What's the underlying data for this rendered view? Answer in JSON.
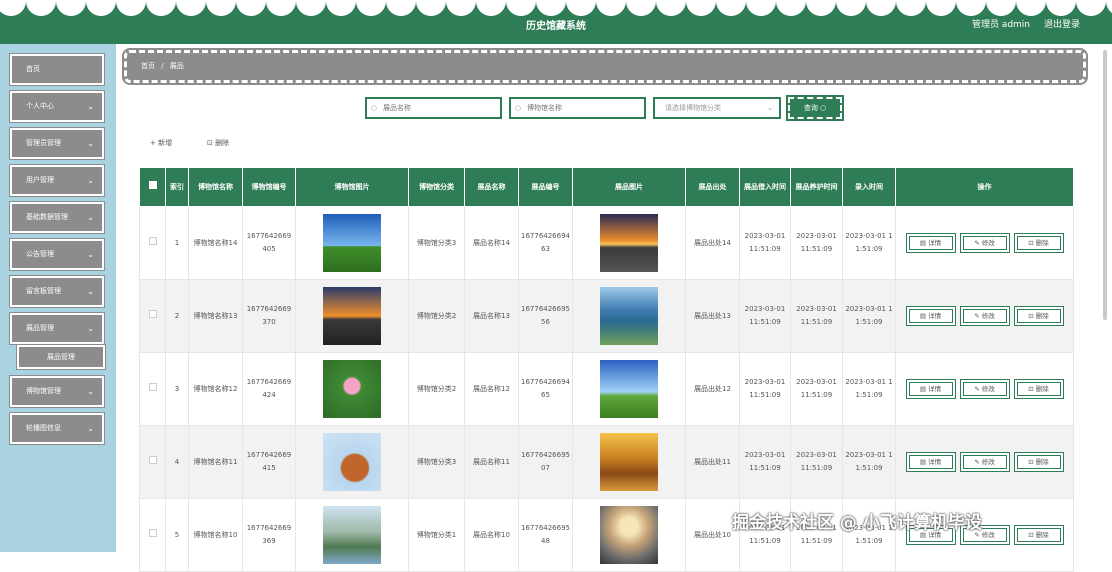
{
  "header": {
    "title": "历史馆藏系统",
    "user": "管理员 admin",
    "logout": "退出登录"
  },
  "sidebar": {
    "items": [
      {
        "label": "首页",
        "chevron": false
      },
      {
        "label": "个人中心",
        "chevron": true
      },
      {
        "label": "管理员管理",
        "chevron": true
      },
      {
        "label": "用户管理",
        "chevron": true
      },
      {
        "label": "基础数据管理",
        "chevron": true
      },
      {
        "label": "公告管理",
        "chevron": true
      },
      {
        "label": "留言板管理",
        "chevron": true
      },
      {
        "label": "展品管理",
        "chevron": true
      },
      {
        "label": "博物馆管理",
        "chevron": true
      },
      {
        "label": "轮播图信息",
        "chevron": true
      }
    ],
    "sub_item": "展品管理"
  },
  "breadcrumb": {
    "home": "首页",
    "sep": "/",
    "current": "展品"
  },
  "search": {
    "name_placeholder": "展品名称",
    "museum_placeholder": "博物馆名称",
    "category_placeholder": "请选择博物馆分类",
    "button": "查询"
  },
  "toolbar": {
    "add": "+ 新增",
    "delete": "删除"
  },
  "table": {
    "headers": [
      "索引",
      "博物馆名称",
      "博物馆编号",
      "博物馆图片",
      "博物馆分类",
      "展品名称",
      "展品编号",
      "展品图片",
      "展品出处",
      "展品借入时间",
      "展品养护时间",
      "录入时间",
      "操作"
    ],
    "rows": [
      {
        "idx": "1",
        "museum": "博物馆名称14",
        "museum_no": "1677642669405",
        "category": "博物馆分类3",
        "name": "展品名称14",
        "no": "1677642669463",
        "origin": "展品出处14",
        "borrow": "2023-03-01 11:51:09",
        "care": "2023-03-01 11:51:09",
        "entry": "2023-03-01 11:51:09"
      },
      {
        "idx": "2",
        "museum": "博物馆名称13",
        "museum_no": "1677642669370",
        "category": "博物馆分类2",
        "name": "展品名称13",
        "no": "1677642669556",
        "origin": "展品出处13",
        "borrow": "2023-03-01 11:51:09",
        "care": "2023-03-01 11:51:09",
        "entry": "2023-03-01 11:51:09"
      },
      {
        "idx": "3",
        "museum": "博物馆名称12",
        "museum_no": "1677642669424",
        "category": "博物馆分类2",
        "name": "展品名称12",
        "no": "1677642669465",
        "origin": "展品出处12",
        "borrow": "2023-03-01 11:51:09",
        "care": "2023-03-01 11:51:09",
        "entry": "2023-03-01 11:51:09"
      },
      {
        "idx": "4",
        "museum": "博物馆名称11",
        "museum_no": "1677642669415",
        "category": "博物馆分类3",
        "name": "展品名称11",
        "no": "1677642669507",
        "origin": "展品出处11",
        "borrow": "2023-03-01 11:51:09",
        "care": "2023-03-01 11:51:09",
        "entry": "2023-03-01 11:51:09"
      },
      {
        "idx": "5",
        "museum": "博物馆名称10",
        "museum_no": "1677642669369",
        "category": "博物馆分类1",
        "name": "展品名称10",
        "no": "1677642669548",
        "origin": "展品出处10",
        "borrow": "2023-03-01 11:51:09",
        "care": "2023-03-01 11:51:09",
        "entry": "2023-03-01 11:51:09"
      }
    ],
    "actions": {
      "detail": "详情",
      "edit": "修改",
      "delete": "删除"
    }
  },
  "watermark": "掘金技术社区 @ 小飞计算机毕设",
  "colors": {
    "primary": "#2f7d56",
    "sidebar_bg": "#a9d3e1",
    "item_bg": "#8c8c8c"
  }
}
